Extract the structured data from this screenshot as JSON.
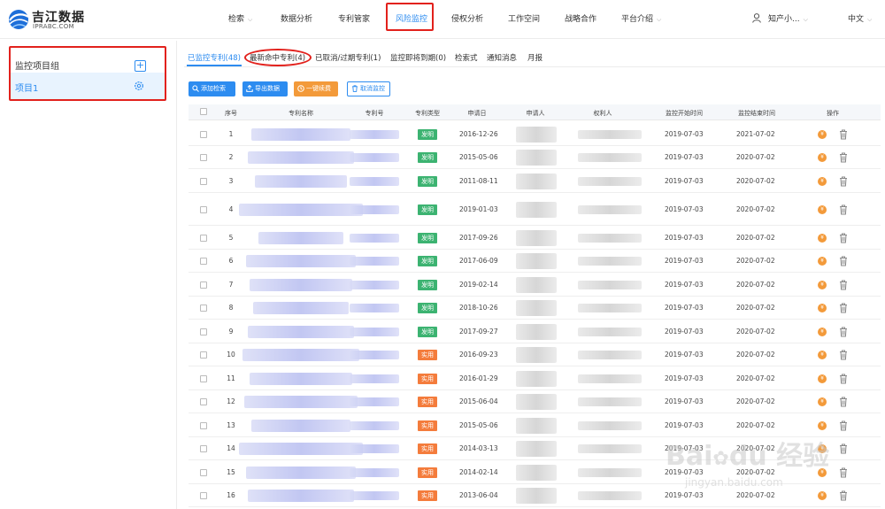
{
  "brand": {
    "name": "吉江数据",
    "sub": "IPRABC.COM",
    "logo_icon": "globe-swoosh-logo"
  },
  "nav": {
    "items": [
      {
        "label": "检索",
        "has_dropdown": true
      },
      {
        "label": "数据分析",
        "has_dropdown": false
      },
      {
        "label": "专利管家",
        "has_dropdown": false
      },
      {
        "label": "风险监控",
        "has_dropdown": false,
        "active": true
      },
      {
        "label": "侵权分析",
        "has_dropdown": false
      },
      {
        "label": "工作空间",
        "has_dropdown": false
      },
      {
        "label": "战略合作",
        "has_dropdown": false
      },
      {
        "label": "平台介绍",
        "has_dropdown": true
      }
    ],
    "user": "知产小...",
    "language": "中文",
    "chevron": "⌵",
    "user_icon": "user-icon"
  },
  "sidebar": {
    "title": "监控项目组",
    "add_symbol": "+",
    "project": "项目1",
    "add_icon": "plus-square-icon",
    "settings_icon": "gear-icon"
  },
  "tabs": [
    {
      "label": "已监控专利(48)",
      "active": true
    },
    {
      "label": "最新命中专利(4)"
    },
    {
      "label": "已取消/过期专利(1)"
    },
    {
      "label": "监控即将到期(0)"
    },
    {
      "label": "检索式"
    },
    {
      "label": "通知消息"
    },
    {
      "label": "月报"
    }
  ],
  "toolbar": {
    "add_search": "添加检索",
    "export": "导出数据",
    "one_click": "一键续费",
    "cancel": "取消监控"
  },
  "table": {
    "columns": [
      "序号",
      "专利名称",
      "专利号",
      "专利类型",
      "申请日",
      "申请人",
      "权利人",
      "监控开始时间",
      "监控结束时间",
      "操作"
    ],
    "type_colors": {
      "发明": "#3cb371",
      "实用": "#f47c3c"
    },
    "action_icons": [
      "renew-coin-icon",
      "trash-icon"
    ],
    "coin_symbol": "¥",
    "rows": [
      {
        "no": "1",
        "type": "发明",
        "apply_date": "2016-12-26",
        "start": "2019-07-03",
        "end": "2021-07-02"
      },
      {
        "no": "2",
        "type": "发明",
        "apply_date": "2015-05-06",
        "start": "2019-07-03",
        "end": "2020-07-02"
      },
      {
        "no": "3",
        "type": "发明",
        "apply_date": "2011-08-11",
        "start": "2019-07-03",
        "end": "2020-07-02"
      },
      {
        "no": "4",
        "type": "发明",
        "apply_date": "2019-01-03",
        "start": "2019-07-03",
        "end": "2020-07-02"
      },
      {
        "no": "5",
        "type": "发明",
        "apply_date": "2017-09-26",
        "start": "2019-07-03",
        "end": "2020-07-02"
      },
      {
        "no": "6",
        "type": "发明",
        "apply_date": "2017-06-09",
        "start": "2019-07-03",
        "end": "2020-07-02"
      },
      {
        "no": "7",
        "type": "发明",
        "apply_date": "2019-02-14",
        "start": "2019-07-03",
        "end": "2020-07-02"
      },
      {
        "no": "8",
        "type": "发明",
        "apply_date": "2018-10-26",
        "start": "2019-07-03",
        "end": "2020-07-02"
      },
      {
        "no": "9",
        "type": "发明",
        "apply_date": "2017-09-27",
        "start": "2019-07-03",
        "end": "2020-07-02"
      },
      {
        "no": "10",
        "type": "实用",
        "apply_date": "2016-09-23",
        "start": "2019-07-03",
        "end": "2020-07-02"
      },
      {
        "no": "11",
        "type": "实用",
        "apply_date": "2016-01-29",
        "start": "2019-07-03",
        "end": "2020-07-02"
      },
      {
        "no": "12",
        "type": "实用",
        "apply_date": "2015-06-04",
        "start": "2019-07-03",
        "end": "2020-07-02"
      },
      {
        "no": "13",
        "type": "实用",
        "apply_date": "2015-05-06",
        "start": "2019-07-03",
        "end": "2020-07-02"
      },
      {
        "no": "14",
        "type": "实用",
        "apply_date": "2014-03-13",
        "start": "2019-07-03",
        "end": "2020-07-02"
      },
      {
        "no": "15",
        "type": "实用",
        "apply_date": "2014-02-14",
        "start": "2019-07-03",
        "end": "2020-07-02"
      },
      {
        "no": "16",
        "type": "实用",
        "apply_date": "2013-06-04",
        "start": "2019-07-03",
        "end": "2020-07-02"
      }
    ]
  },
  "watermark": {
    "brand": "Bai",
    "brand_mid": "du",
    "cn": "经验",
    "url": "jingyan.baidu.com"
  }
}
